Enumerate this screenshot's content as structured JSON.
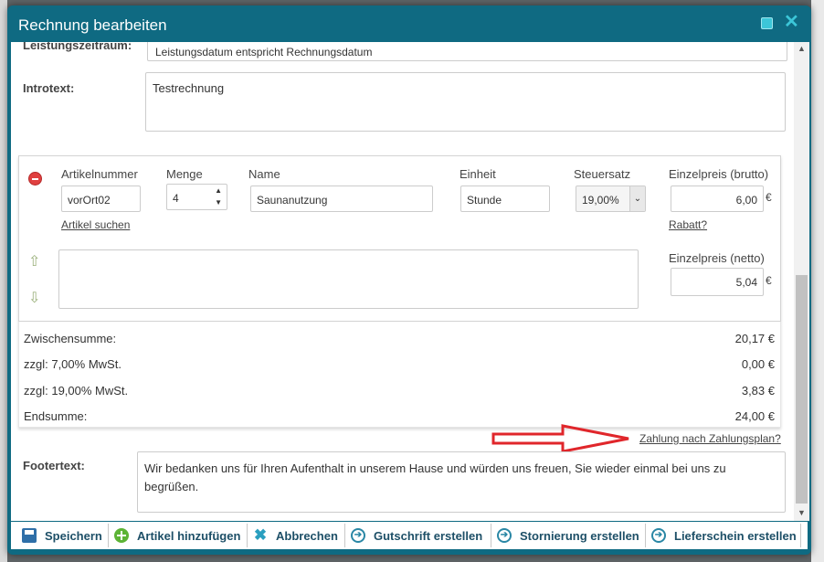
{
  "dialog": {
    "title": "Rechnung bearbeiten"
  },
  "form": {
    "leistungszeitraum_label": "Leistungszeitraum:",
    "leistungszeitraum_value": "Leistungsdatum entspricht Rechnungsdatum",
    "introtext_label": "Introtext:",
    "introtext_value": "Testrechnung",
    "footertext_label": "Footertext:",
    "footertext_value": "Wir bedanken uns für Ihren Aufenthalt in unserem Hause und würden uns freuen, Sie wieder einmal bei uns zu begrüßen."
  },
  "article": {
    "artikelnummer_label": "Artikelnummer",
    "artikelnummer_value": "vorOrt02",
    "artikel_suchen_link": "Artikel suchen",
    "menge_label": "Menge",
    "menge_value": "4",
    "name_label": "Name",
    "name_value": "Saunanutzung",
    "einheit_label": "Einheit",
    "einheit_value": "Stunde",
    "steuersatz_label": "Steuersatz",
    "steuersatz_value": "19,00%",
    "brutto_label": "Einzelpreis (brutto)",
    "brutto_value": "6,00",
    "rabatt_link": "Rabatt?",
    "netto_label": "Einzelpreis (netto)",
    "netto_value": "5,04",
    "currency": "€",
    "description_value": ""
  },
  "totals": {
    "rows": [
      {
        "label": "Zwischensumme:",
        "value": "20,17 €"
      },
      {
        "label": "zzgl: 7,00% MwSt.",
        "value": "0,00 €"
      },
      {
        "label": "zzgl: 19,00% MwSt.",
        "value": "3,83 €"
      },
      {
        "label": "Endsumme:",
        "value": "24,00 €"
      }
    ]
  },
  "payment_plan_link": "Zahlung nach Zahlungsplan?",
  "buttons": {
    "save": "Speichern",
    "add_article": "Artikel hinzufügen",
    "cancel": "Abbrechen",
    "credit_note": "Gutschrift erstellen",
    "cancellation": "Stornierung erstellen",
    "delivery_note": "Lieferschein erstellen"
  },
  "colors": {
    "titlebar": "#0f6a82",
    "button_text": "#1d4f67",
    "annotation_arrow": "#e0262b"
  },
  "icons": {
    "remove": "remove-circle-icon",
    "move_up": "arrow-up-icon",
    "move_down": "arrow-down-icon",
    "save": "floppy-disk-icon",
    "add": "plus-circle-icon",
    "cancel": "x-icon",
    "go": "arrow-circle-right-icon"
  }
}
